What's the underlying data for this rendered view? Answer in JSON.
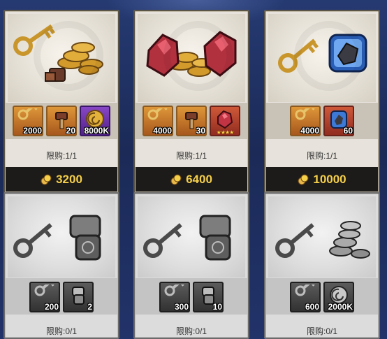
{
  "cards": [
    {
      "items": [
        {
          "qty": "2000",
          "icon": "key-icon"
        },
        {
          "qty": "20",
          "icon": "hammer-icon"
        },
        {
          "qty": "8000K",
          "icon": "gold-swirl-icon"
        }
      ],
      "limit": "限购:1/1",
      "price": "3200"
    },
    {
      "items": [
        {
          "qty": "4000",
          "icon": "key-icon"
        },
        {
          "qty": "30",
          "icon": "hammer-icon"
        },
        {
          "qty": "",
          "icon": "red-gem-icon",
          "stars": "★★★★"
        }
      ],
      "limit": "限购:1/1",
      "price": "6400"
    },
    {
      "items": [
        {
          "qty": "4000",
          "icon": "key-icon"
        },
        {
          "qty": "60",
          "icon": "blue-crystal-icon"
        }
      ],
      "limit": "限购:1/1",
      "price": "10000"
    },
    {
      "items": [
        {
          "qty": "200",
          "icon": "key-icon"
        },
        {
          "qty": "2",
          "icon": "gauntlet-icon"
        }
      ],
      "limit": "限购:0/1"
    },
    {
      "items": [
        {
          "qty": "300",
          "icon": "key-icon"
        },
        {
          "qty": "10",
          "icon": "gauntlet-icon"
        }
      ],
      "limit": "限购:0/1"
    },
    {
      "items": [
        {
          "qty": "600",
          "icon": "key-icon"
        },
        {
          "qty": "2000K",
          "icon": "silver-swirl-icon"
        }
      ],
      "limit": "限购:0/1"
    }
  ],
  "colors": {
    "price": "#f4cf4a",
    "panel": "#1d1b1a",
    "bg": "#1f2f60"
  }
}
